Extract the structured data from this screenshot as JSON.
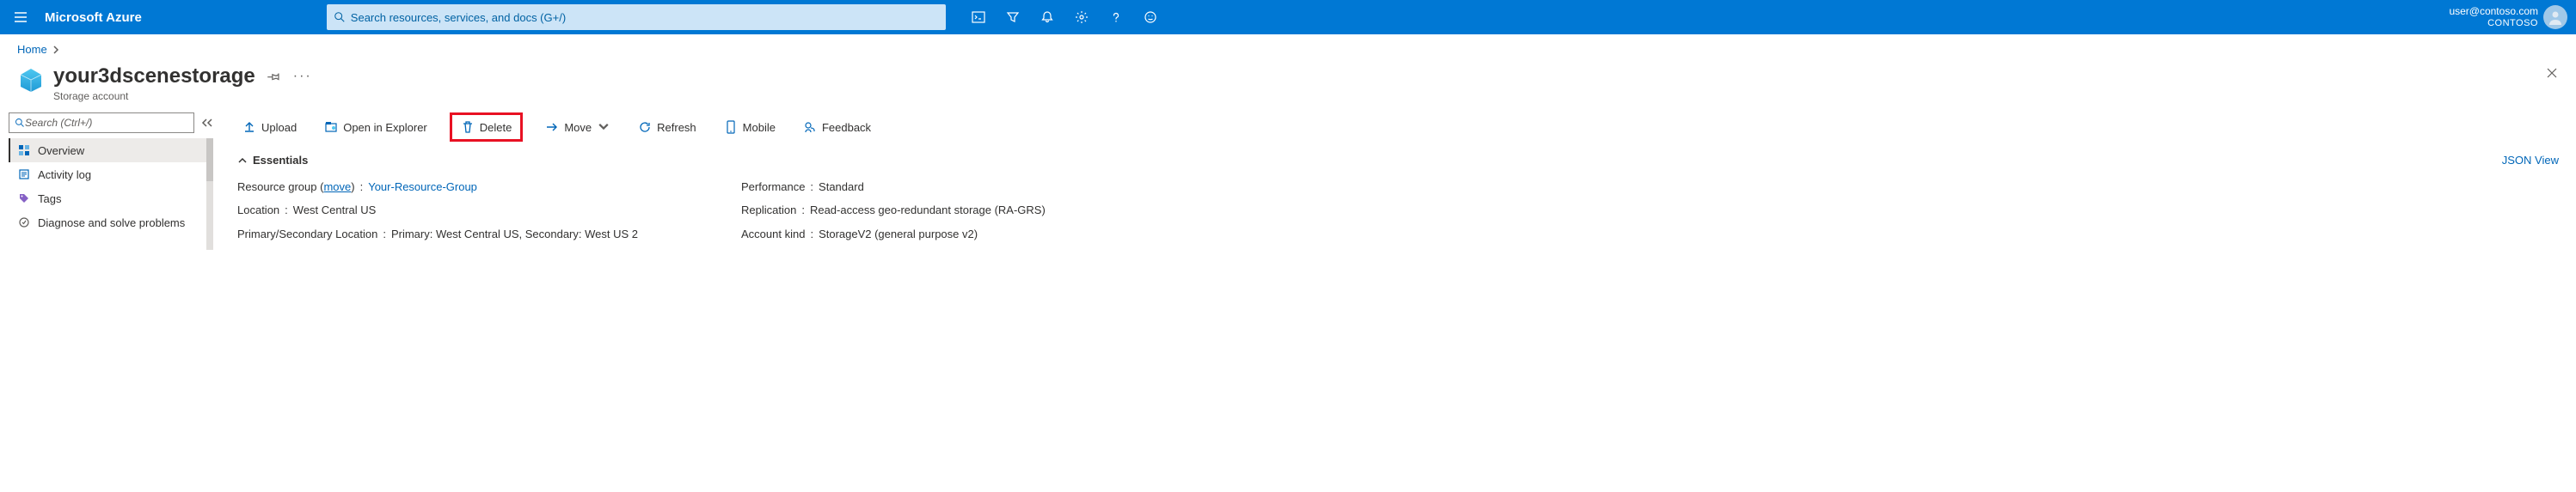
{
  "header": {
    "brand": "Microsoft Azure",
    "search_placeholder": "Search resources, services, and docs (G+/)",
    "user_email": "user@contoso.com",
    "tenant": "CONTOSO"
  },
  "breadcrumb": {
    "home": "Home"
  },
  "page": {
    "title": "your3dscenestorage",
    "subtitle": "Storage account"
  },
  "left": {
    "search_placeholder": "Search (Ctrl+/)",
    "items": [
      {
        "label": "Overview"
      },
      {
        "label": "Activity log"
      },
      {
        "label": "Tags"
      },
      {
        "label": "Diagnose and solve problems"
      }
    ]
  },
  "commands": {
    "upload": "Upload",
    "open_explorer": "Open in Explorer",
    "delete": "Delete",
    "move": "Move",
    "refresh": "Refresh",
    "mobile": "Mobile",
    "feedback": "Feedback"
  },
  "essentials": {
    "label": "Essentials",
    "json_view": "JSON View",
    "move_label": "move",
    "left": [
      {
        "key": "Resource group",
        "has_move": true,
        "val": "Your-Resource-Group",
        "link": true
      },
      {
        "key": "Location",
        "val": "West Central US"
      },
      {
        "key": "Primary/Secondary Location",
        "val": "Primary: West Central US, Secondary: West US 2"
      }
    ],
    "right": [
      {
        "key": "Performance",
        "val": "Standard"
      },
      {
        "key": "Replication",
        "val": "Read-access geo-redundant storage (RA-GRS)"
      },
      {
        "key": "Account kind",
        "val": "StorageV2 (general purpose v2)"
      }
    ]
  }
}
